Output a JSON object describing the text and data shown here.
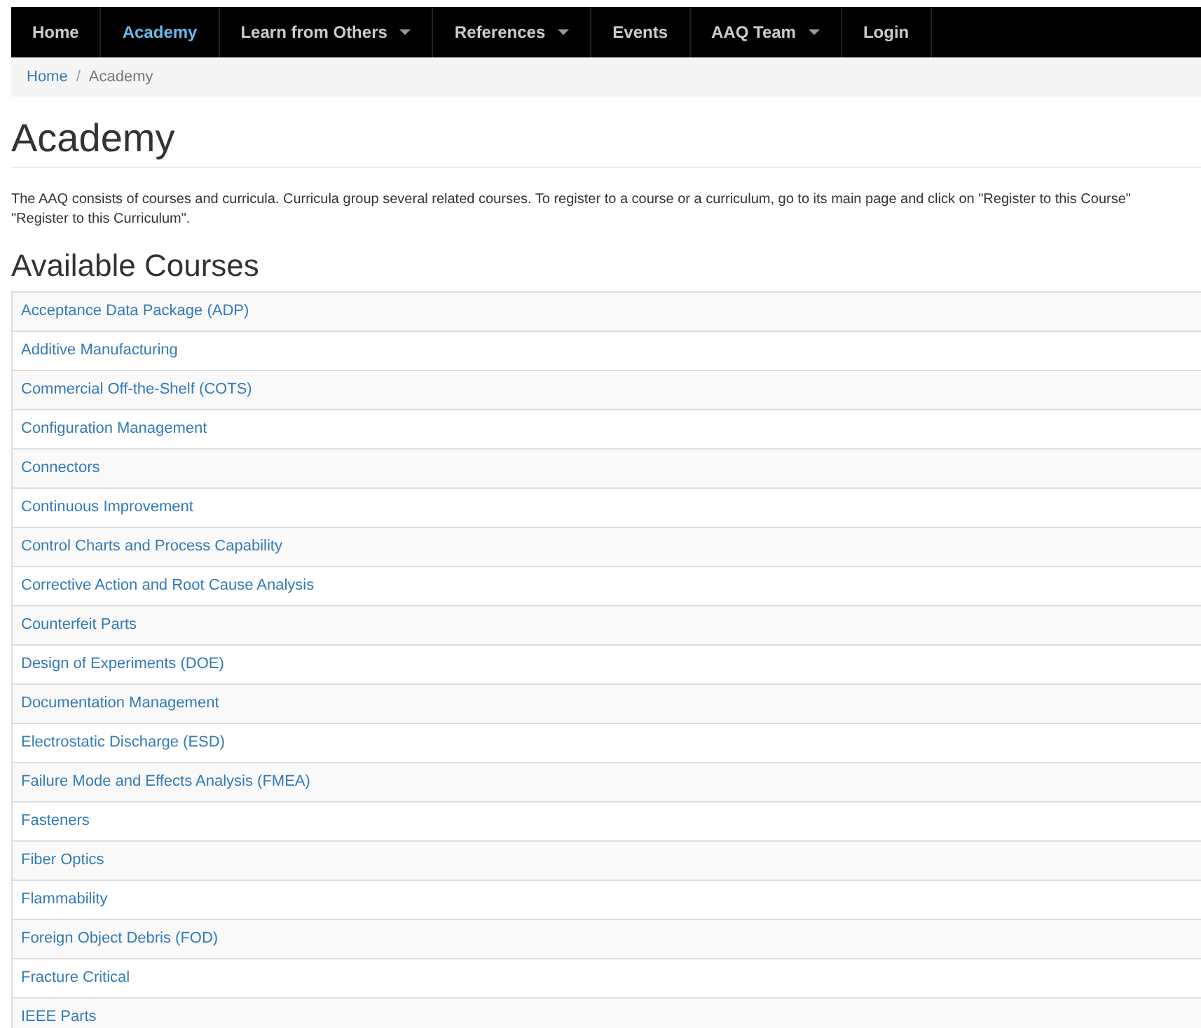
{
  "nav": [
    {
      "label": "Home",
      "selected": false,
      "dropdown": false
    },
    {
      "label": "Academy",
      "selected": true,
      "dropdown": false
    },
    {
      "label": "Learn from Others",
      "selected": false,
      "dropdown": true
    },
    {
      "label": "References",
      "selected": false,
      "dropdown": true
    },
    {
      "label": "Events",
      "selected": false,
      "dropdown": false
    },
    {
      "label": "AAQ Team",
      "selected": false,
      "dropdown": true
    },
    {
      "label": "Login",
      "selected": false,
      "dropdown": false
    }
  ],
  "breadcrumb": [
    "Home",
    "Academy"
  ],
  "breadcrumb_separator": "/",
  "title": "Academy",
  "intro_lines": [
    "The AAQ consists of courses and curricula. Curricula group several related courses. To register to a course or a curriculum, go to its main page and click on \"Register to this Course\"",
    "\"Register to this Curriculum\"."
  ],
  "courses_heading": "Available Courses",
  "courses": [
    "Acceptance Data Package (ADP)",
    "Additive Manufacturing",
    "Commercial Off-the-Shelf (COTS)",
    "Configuration Management",
    "Connectors",
    "Continuous Improvement",
    "Control Charts and Process Capability",
    "Corrective Action and Root Cause Analysis",
    "Counterfeit Parts",
    "Design of Experiments (DOE)",
    "Documentation Management",
    "Electrostatic Discharge (ESD)",
    "Failure Mode and Effects Analysis (FMEA)",
    "Fasteners",
    "Fiber Optics",
    "Flammability",
    "Foreign Object Debris (FOD)",
    "Fracture Critical",
    "IEEE Parts"
  ]
}
